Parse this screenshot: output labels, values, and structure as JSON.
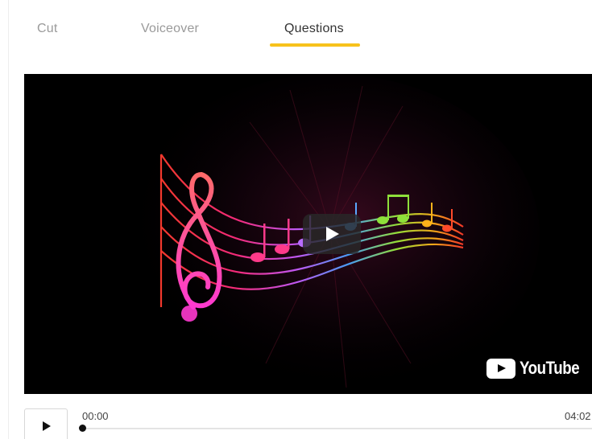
{
  "tabs": [
    {
      "label": "Cut",
      "active": false
    },
    {
      "label": "Voiceover",
      "active": false
    },
    {
      "label": "Questions",
      "active": true
    }
  ],
  "accent_color": "#f7c21c",
  "video": {
    "play_icon": "play-icon",
    "brand_logo_text": "YouTube",
    "brand_icon": "youtube-play-icon"
  },
  "player": {
    "current_time": "00:00",
    "duration": "04:02",
    "progress": 0,
    "play_icon": "play-icon"
  }
}
